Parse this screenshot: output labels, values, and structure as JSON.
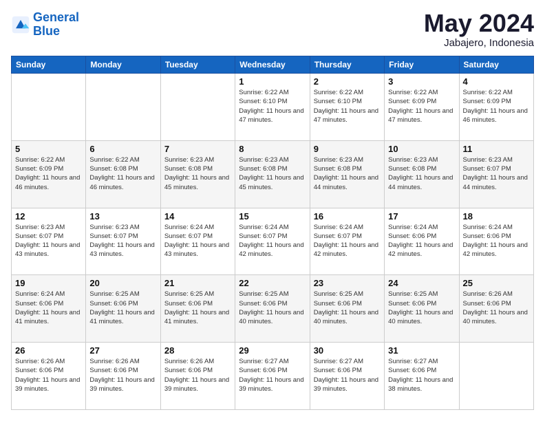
{
  "logo": {
    "line1": "General",
    "line2": "Blue"
  },
  "title": "May 2024",
  "subtitle": "Jabajero, Indonesia",
  "days_of_week": [
    "Sunday",
    "Monday",
    "Tuesday",
    "Wednesday",
    "Thursday",
    "Friday",
    "Saturday"
  ],
  "weeks": [
    [
      {
        "day": "",
        "info": ""
      },
      {
        "day": "",
        "info": ""
      },
      {
        "day": "",
        "info": ""
      },
      {
        "day": "1",
        "info": "Sunrise: 6:22 AM\nSunset: 6:10 PM\nDaylight: 11 hours and 47 minutes."
      },
      {
        "day": "2",
        "info": "Sunrise: 6:22 AM\nSunset: 6:10 PM\nDaylight: 11 hours and 47 minutes."
      },
      {
        "day": "3",
        "info": "Sunrise: 6:22 AM\nSunset: 6:09 PM\nDaylight: 11 hours and 47 minutes."
      },
      {
        "day": "4",
        "info": "Sunrise: 6:22 AM\nSunset: 6:09 PM\nDaylight: 11 hours and 46 minutes."
      }
    ],
    [
      {
        "day": "5",
        "info": "Sunrise: 6:22 AM\nSunset: 6:09 PM\nDaylight: 11 hours and 46 minutes."
      },
      {
        "day": "6",
        "info": "Sunrise: 6:22 AM\nSunset: 6:08 PM\nDaylight: 11 hours and 46 minutes."
      },
      {
        "day": "7",
        "info": "Sunrise: 6:23 AM\nSunset: 6:08 PM\nDaylight: 11 hours and 45 minutes."
      },
      {
        "day": "8",
        "info": "Sunrise: 6:23 AM\nSunset: 6:08 PM\nDaylight: 11 hours and 45 minutes."
      },
      {
        "day": "9",
        "info": "Sunrise: 6:23 AM\nSunset: 6:08 PM\nDaylight: 11 hours and 44 minutes."
      },
      {
        "day": "10",
        "info": "Sunrise: 6:23 AM\nSunset: 6:08 PM\nDaylight: 11 hours and 44 minutes."
      },
      {
        "day": "11",
        "info": "Sunrise: 6:23 AM\nSunset: 6:07 PM\nDaylight: 11 hours and 44 minutes."
      }
    ],
    [
      {
        "day": "12",
        "info": "Sunrise: 6:23 AM\nSunset: 6:07 PM\nDaylight: 11 hours and 43 minutes."
      },
      {
        "day": "13",
        "info": "Sunrise: 6:23 AM\nSunset: 6:07 PM\nDaylight: 11 hours and 43 minutes."
      },
      {
        "day": "14",
        "info": "Sunrise: 6:24 AM\nSunset: 6:07 PM\nDaylight: 11 hours and 43 minutes."
      },
      {
        "day": "15",
        "info": "Sunrise: 6:24 AM\nSunset: 6:07 PM\nDaylight: 11 hours and 42 minutes."
      },
      {
        "day": "16",
        "info": "Sunrise: 6:24 AM\nSunset: 6:07 PM\nDaylight: 11 hours and 42 minutes."
      },
      {
        "day": "17",
        "info": "Sunrise: 6:24 AM\nSunset: 6:06 PM\nDaylight: 11 hours and 42 minutes."
      },
      {
        "day": "18",
        "info": "Sunrise: 6:24 AM\nSunset: 6:06 PM\nDaylight: 11 hours and 42 minutes."
      }
    ],
    [
      {
        "day": "19",
        "info": "Sunrise: 6:24 AM\nSunset: 6:06 PM\nDaylight: 11 hours and 41 minutes."
      },
      {
        "day": "20",
        "info": "Sunrise: 6:25 AM\nSunset: 6:06 PM\nDaylight: 11 hours and 41 minutes."
      },
      {
        "day": "21",
        "info": "Sunrise: 6:25 AM\nSunset: 6:06 PM\nDaylight: 11 hours and 41 minutes."
      },
      {
        "day": "22",
        "info": "Sunrise: 6:25 AM\nSunset: 6:06 PM\nDaylight: 11 hours and 40 minutes."
      },
      {
        "day": "23",
        "info": "Sunrise: 6:25 AM\nSunset: 6:06 PM\nDaylight: 11 hours and 40 minutes."
      },
      {
        "day": "24",
        "info": "Sunrise: 6:25 AM\nSunset: 6:06 PM\nDaylight: 11 hours and 40 minutes."
      },
      {
        "day": "25",
        "info": "Sunrise: 6:26 AM\nSunset: 6:06 PM\nDaylight: 11 hours and 40 minutes."
      }
    ],
    [
      {
        "day": "26",
        "info": "Sunrise: 6:26 AM\nSunset: 6:06 PM\nDaylight: 11 hours and 39 minutes."
      },
      {
        "day": "27",
        "info": "Sunrise: 6:26 AM\nSunset: 6:06 PM\nDaylight: 11 hours and 39 minutes."
      },
      {
        "day": "28",
        "info": "Sunrise: 6:26 AM\nSunset: 6:06 PM\nDaylight: 11 hours and 39 minutes."
      },
      {
        "day": "29",
        "info": "Sunrise: 6:27 AM\nSunset: 6:06 PM\nDaylight: 11 hours and 39 minutes."
      },
      {
        "day": "30",
        "info": "Sunrise: 6:27 AM\nSunset: 6:06 PM\nDaylight: 11 hours and 39 minutes."
      },
      {
        "day": "31",
        "info": "Sunrise: 6:27 AM\nSunset: 6:06 PM\nDaylight: 11 hours and 38 minutes."
      },
      {
        "day": "",
        "info": ""
      }
    ]
  ]
}
